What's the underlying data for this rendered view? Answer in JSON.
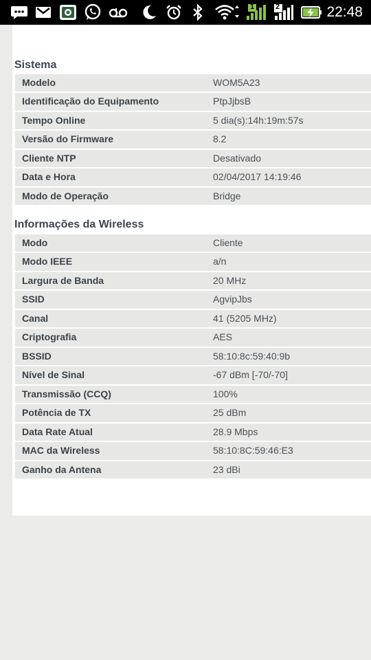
{
  "status_bar": {
    "time": "22:48",
    "signal_badge": "1",
    "signal2_badge": "2",
    "icons": [
      "messages-icon",
      "gmail-icon",
      "app-icon",
      "whatsapp-icon",
      "voicemail-icon",
      "moon-icon",
      "alarm-icon",
      "bluetooth-icon",
      "wifi-icon",
      "signal-icon",
      "battery-charging-icon"
    ]
  },
  "sistema": {
    "title": "Sistema",
    "rows": [
      {
        "label": "Modelo",
        "value": "WOM5A23"
      },
      {
        "label": "Identificação do Equipamento",
        "value": "PtpJjbsB"
      },
      {
        "label": "Tempo Online",
        "value": "5 dia(s):14h:19m:57s"
      },
      {
        "label": "Versão do Firmware",
        "value": "8.2"
      },
      {
        "label": "Cliente NTP",
        "value": "Desativado"
      },
      {
        "label": "Data e Hora",
        "value": "02/04/2017 14:19:46"
      },
      {
        "label": "Modo de Operação",
        "value": "Bridge"
      }
    ]
  },
  "wireless": {
    "title": "Informações da Wireless",
    "rows": [
      {
        "label": "Modo",
        "value": "Cliente"
      },
      {
        "label": "Modo IEEE",
        "value": "a/n"
      },
      {
        "label": "Largura de Banda",
        "value": "20 MHz"
      },
      {
        "label": "SSID",
        "value": "AgvipJbs"
      },
      {
        "label": "Canal",
        "value": "41 (5205 MHz)"
      },
      {
        "label": "Criptografia",
        "value": "AES"
      },
      {
        "label": "BSSID",
        "value": "58:10:8c:59:40:9b"
      },
      {
        "label": "Nível de Sinal",
        "value": "-67 dBm [-70/-70]"
      },
      {
        "label": "Transmissão (CCQ)",
        "value": "100%"
      },
      {
        "label": "Potência de TX",
        "value": "25 dBm"
      },
      {
        "label": "Data Rate Atual",
        "value": "28.9 Mbps"
      },
      {
        "label": "MAC da Wireless",
        "value": "58:10:8C:59:46:E3"
      },
      {
        "label": "Ganho da Antena",
        "value": "23 dBi"
      }
    ]
  },
  "colors": {
    "background": "#ebecea",
    "panel": "#ffffff",
    "row": "#e7e8e6",
    "label_text": "#3b4248",
    "heading_text": "#3d4650",
    "battery_accent": "#8bc34a"
  }
}
